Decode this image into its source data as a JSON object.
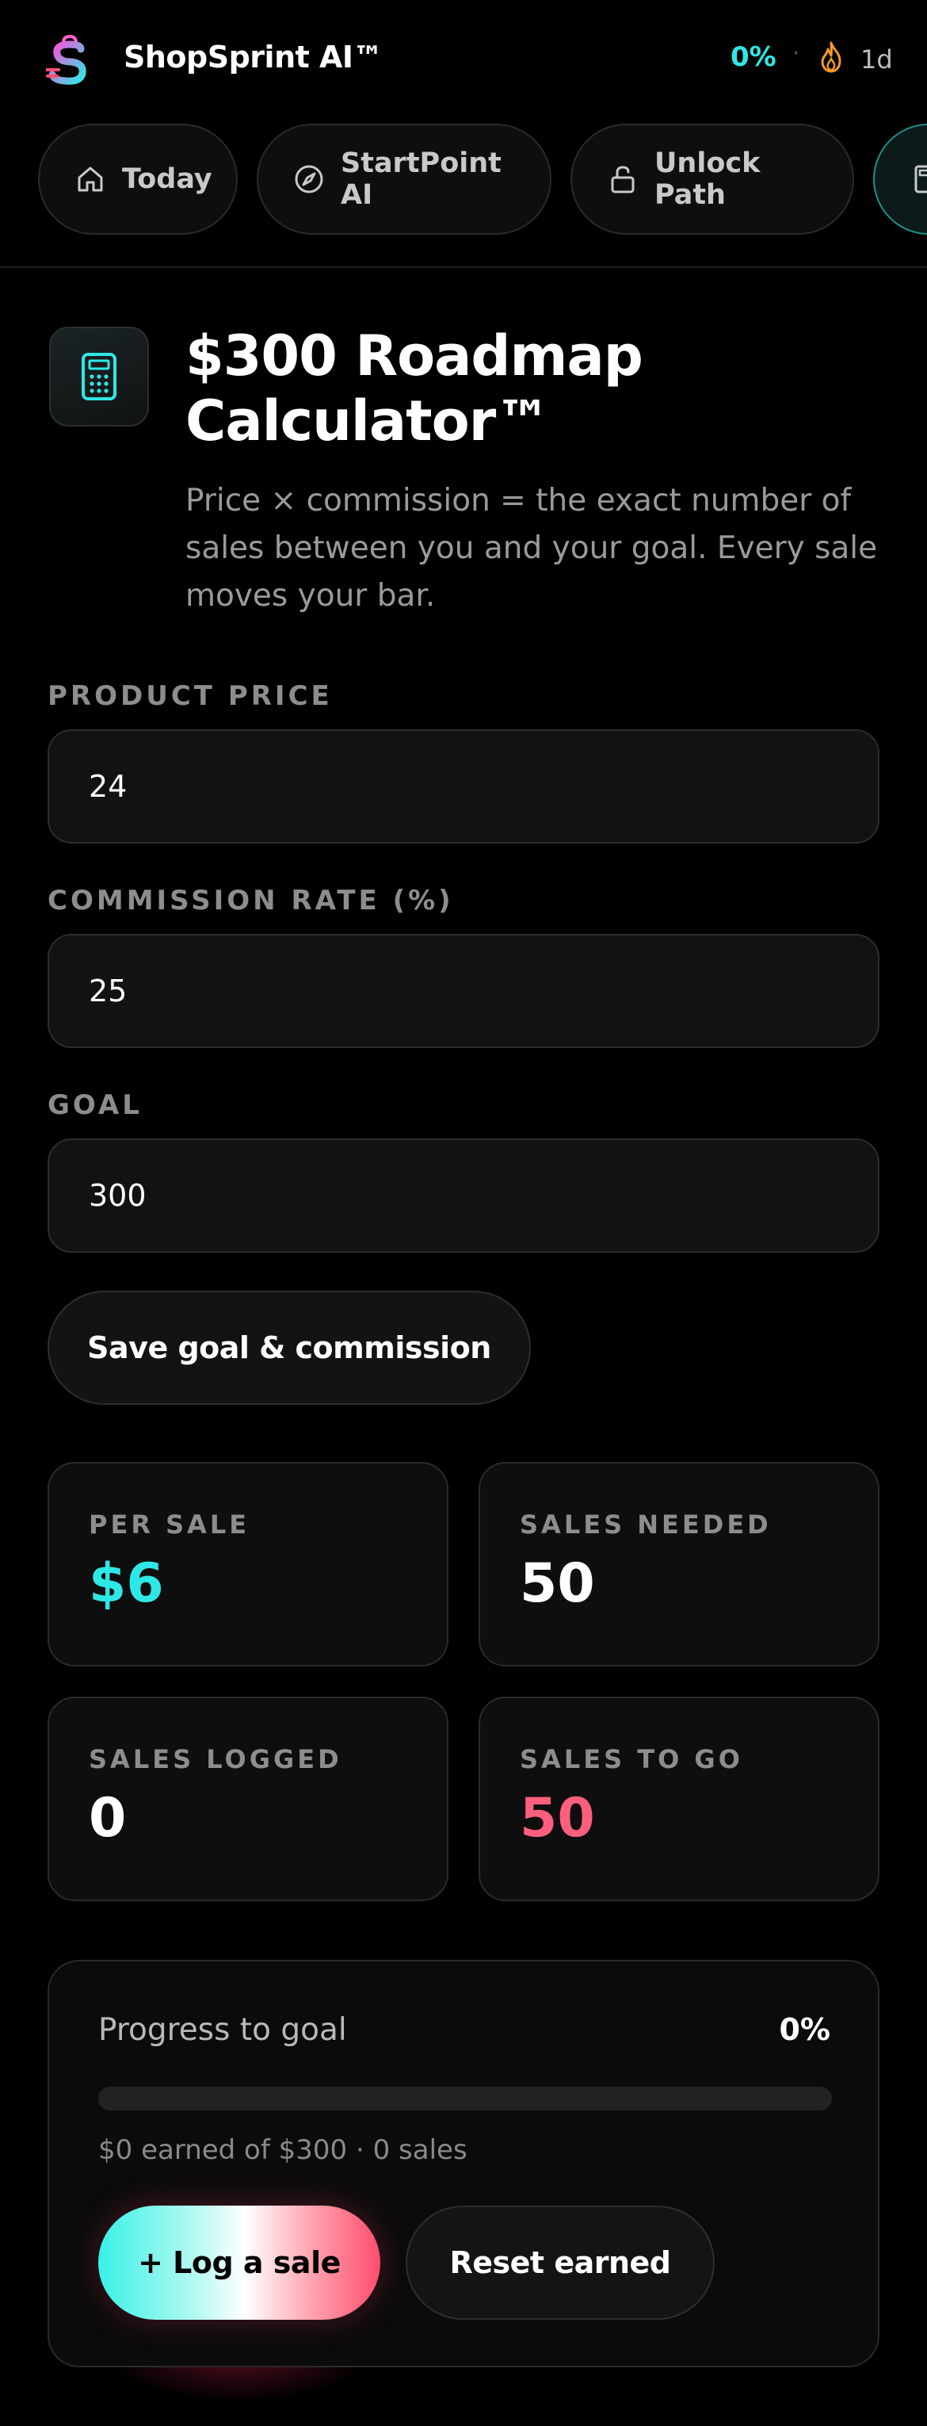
{
  "header": {
    "brand": "ShopSprint AI™",
    "progress_pct": "0%",
    "separator": "·",
    "streak": "1d"
  },
  "tabs": [
    {
      "label": "Today",
      "icon": "home-icon"
    },
    {
      "label": "StartPoint AI",
      "icon": "compass-icon"
    },
    {
      "label": "Unlock Path",
      "icon": "lock-open-icon"
    },
    {
      "label": "",
      "icon": "calculator-icon",
      "active": true
    }
  ],
  "hero": {
    "icon": "calculator-icon",
    "title": "$300 Roadmap Calculator™",
    "subtitle": "Price × commission = the exact number of sales between you and your goal. Every sale moves your bar."
  },
  "form": {
    "price_label": "PRODUCT PRICE",
    "price_value": "24",
    "commission_label": "COMMISSION RATE (%)",
    "commission_value": "25",
    "goal_label": "GOAL",
    "goal_value": "300",
    "save_label": "Save goal & commission"
  },
  "stats": {
    "per_sale": {
      "label": "PER SALE",
      "value": "$6"
    },
    "sales_needed": {
      "label": "SALES NEEDED",
      "value": "50"
    },
    "sales_logged": {
      "label": "SALES LOGGED",
      "value": "0"
    },
    "sales_to_go": {
      "label": "SALES TO GO",
      "value": "50"
    }
  },
  "progress": {
    "label": "Progress to goal",
    "pct_text": "0%",
    "fraction": 0,
    "summary": "$0 earned of $300 · 0 sales",
    "log_label": "+ Log a sale",
    "reset_label": "Reset earned"
  },
  "colors": {
    "accent_cyan": "#2ee8e6",
    "accent_pink": "#ff5f7e",
    "streak_orange": "#f59a23",
    "background": "#000000"
  }
}
